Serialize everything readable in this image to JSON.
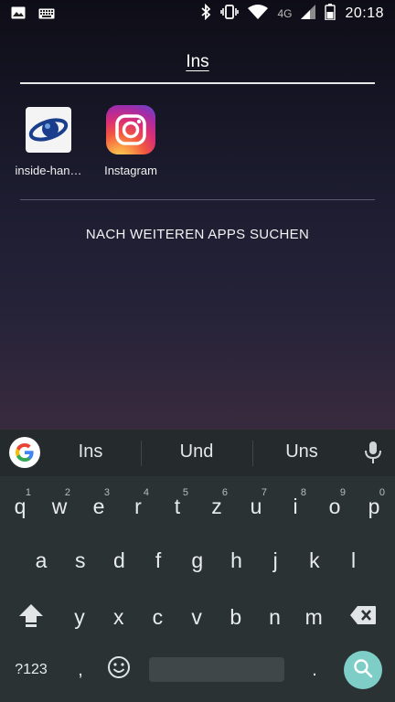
{
  "status_bar": {
    "network": "4G",
    "time": "20:18",
    "icons": [
      "image-icon",
      "keyboard-icon",
      "bluetooth-icon",
      "vibrate-icon",
      "wifi-icon",
      "signal-icon",
      "battery-icon"
    ]
  },
  "search": {
    "query": "Ins"
  },
  "apps": [
    {
      "label": "inside-han…",
      "icon": "inside-handy-icon"
    },
    {
      "label": "Instagram",
      "icon": "instagram-icon"
    }
  ],
  "more_apps_label": "NACH WEITEREN APPS SUCHEN",
  "keyboard": {
    "suggestions": [
      "Ins",
      "Und",
      "Uns"
    ],
    "row1": [
      {
        "k": "q",
        "h": "1"
      },
      {
        "k": "w",
        "h": "2"
      },
      {
        "k": "e",
        "h": "3"
      },
      {
        "k": "r",
        "h": "4"
      },
      {
        "k": "t",
        "h": "5"
      },
      {
        "k": "z",
        "h": "6"
      },
      {
        "k": "u",
        "h": "7"
      },
      {
        "k": "i",
        "h": "8"
      },
      {
        "k": "o",
        "h": "9"
      },
      {
        "k": "p",
        "h": "0"
      }
    ],
    "row2": [
      "a",
      "s",
      "d",
      "f",
      "g",
      "h",
      "j",
      "k",
      "l"
    ],
    "row3": [
      "y",
      "x",
      "c",
      "v",
      "b",
      "n",
      "m"
    ],
    "symbols_label": "?123",
    "comma": ",",
    "period": "."
  },
  "colors": {
    "search_key": "#7ecdc7",
    "keyboard_bg": "#2b3234"
  }
}
